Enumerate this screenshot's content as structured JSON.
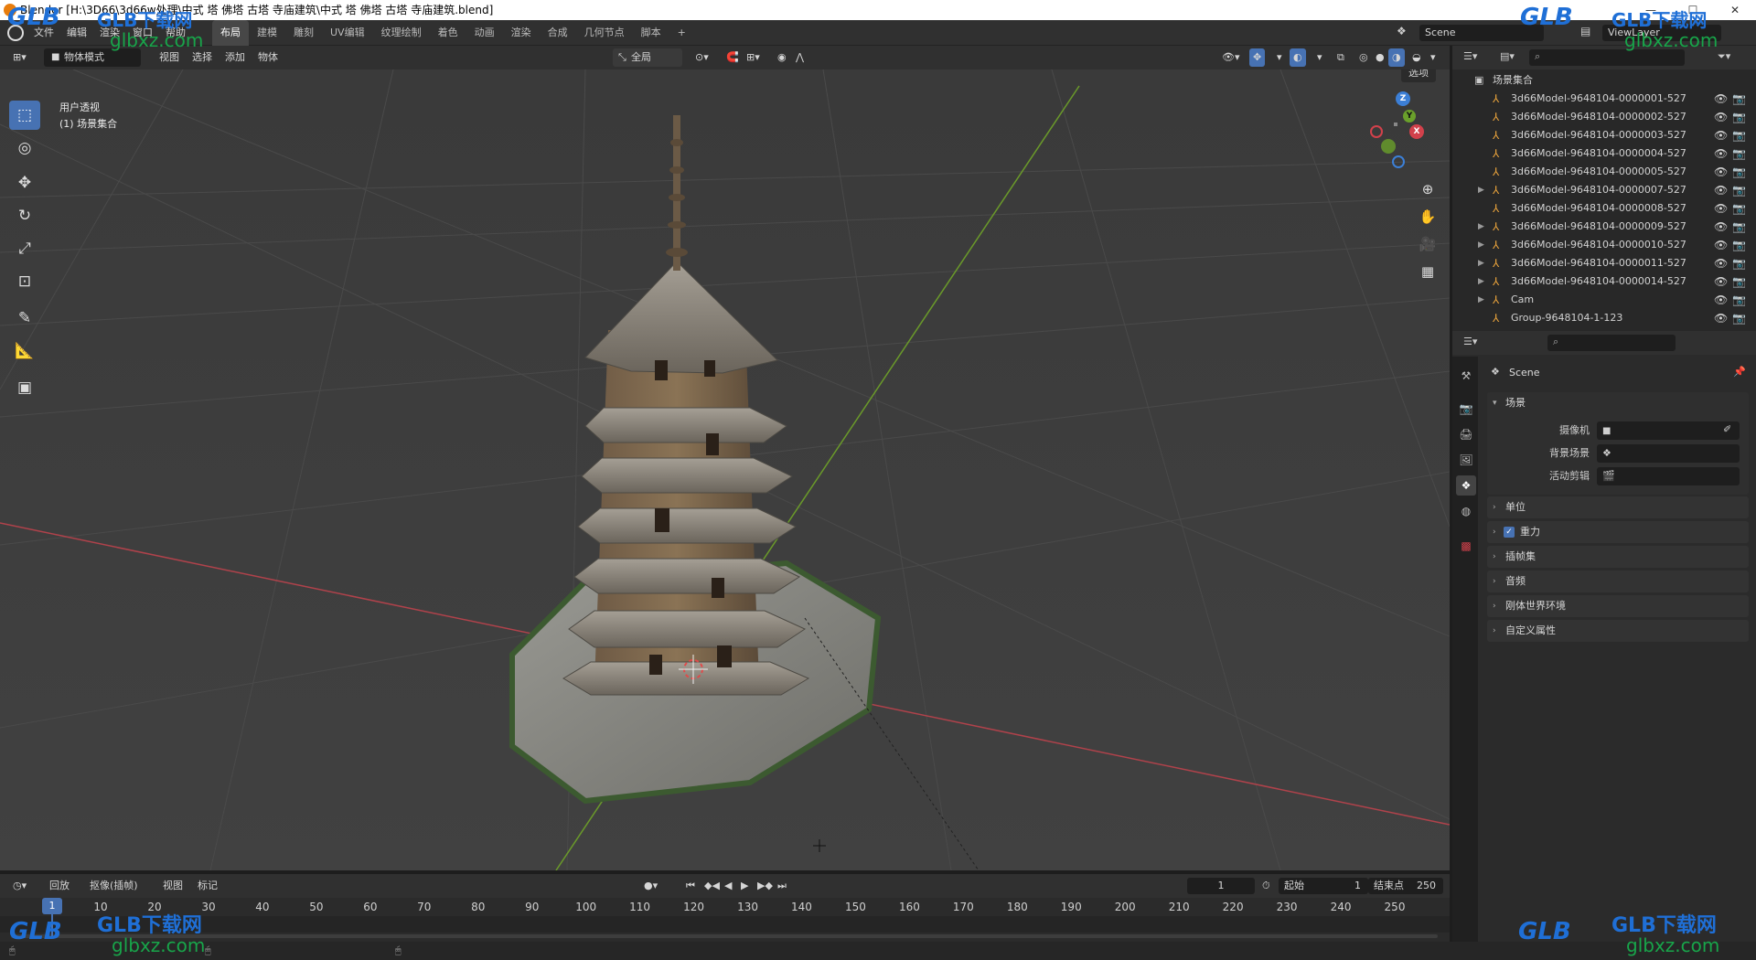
{
  "window": {
    "title": "Blender [H:\\3D66\\3d66w处理\\中式 塔 佛塔 古塔 寺庙建筑\\中式 塔 佛塔 古塔 寺庙建筑.blend]",
    "minimize": "—",
    "maximize": "☐",
    "close": "✕"
  },
  "menu": {
    "items": [
      "文件",
      "编辑",
      "渲染",
      "窗口",
      "帮助"
    ]
  },
  "workspaces": {
    "tabs": [
      "布局",
      "建模",
      "雕刻",
      "UV编辑",
      "纹理绘制",
      "着色",
      "动画",
      "渲染",
      "合成",
      "几何节点",
      "脚本"
    ],
    "add": "+",
    "active": "布局"
  },
  "scene_selector": {
    "value": "Scene"
  },
  "viewlayer_selector": {
    "value": "ViewLayer"
  },
  "viewport_header": {
    "mode": "物体模式",
    "menus": [
      "视图",
      "选择",
      "添加",
      "物体"
    ],
    "orientation": "全局",
    "options": "选项"
  },
  "viewport": {
    "view_name": "用户透视",
    "collection_info": "(1) 场景集合"
  },
  "gizmo": {
    "x": "X",
    "y": "Y",
    "z": "Z"
  },
  "outliner": {
    "root": "场景集合",
    "items": [
      {
        "name": "3d66Model-9648104-0000001-527",
        "expandable": false
      },
      {
        "name": "3d66Model-9648104-0000002-527",
        "expandable": false
      },
      {
        "name": "3d66Model-9648104-0000003-527",
        "expandable": false
      },
      {
        "name": "3d66Model-9648104-0000004-527",
        "expandable": false
      },
      {
        "name": "3d66Model-9648104-0000005-527",
        "expandable": false
      },
      {
        "name": "3d66Model-9648104-0000007-527",
        "expandable": true
      },
      {
        "name": "3d66Model-9648104-0000008-527",
        "expandable": false
      },
      {
        "name": "3d66Model-9648104-0000009-527",
        "expandable": true
      },
      {
        "name": "3d66Model-9648104-0000010-527",
        "expandable": true
      },
      {
        "name": "3d66Model-9648104-0000011-527",
        "expandable": true
      },
      {
        "name": "3d66Model-9648104-0000014-527",
        "expandable": true
      },
      {
        "name": "Cam",
        "expandable": true
      },
      {
        "name": "Group-9648104-1-123",
        "expandable": false
      }
    ]
  },
  "properties": {
    "context_title": "Scene",
    "scene_panel": "场景",
    "camera_label": "摄像机",
    "background_label": "背景场景",
    "active_clip_label": "活动剪辑",
    "panels": [
      "单位",
      "重力",
      "插帧集",
      "音频",
      "刚体世界环境",
      "自定义属性"
    ],
    "gravity_checked": true
  },
  "timeline": {
    "playback": "回放",
    "keying": "抠像(插帧)",
    "view": "视图",
    "marker": "标记",
    "current_frame": "1",
    "start_label": "起始",
    "start_value": "1",
    "end_label": "结束点",
    "end_value": "250",
    "ticks": [
      "1",
      "10",
      "20",
      "30",
      "40",
      "50",
      "60",
      "70",
      "80",
      "90",
      "100",
      "110",
      "120",
      "130",
      "140",
      "150",
      "160",
      "170",
      "180",
      "190",
      "200",
      "210",
      "220",
      "230",
      "240",
      "250"
    ],
    "current": 1,
    "frame_min": 1,
    "frame_max": 250
  },
  "watermark": {
    "brand": "GLB下载网",
    "site": "glbxz.com",
    "logo_text": "GLB"
  },
  "colors": {
    "accent": "#4772b3",
    "object_icon": "#e8a23c",
    "x_axis": "#d2414b",
    "y_axis": "#6aa02b",
    "z_axis": "#3c7fd6"
  }
}
